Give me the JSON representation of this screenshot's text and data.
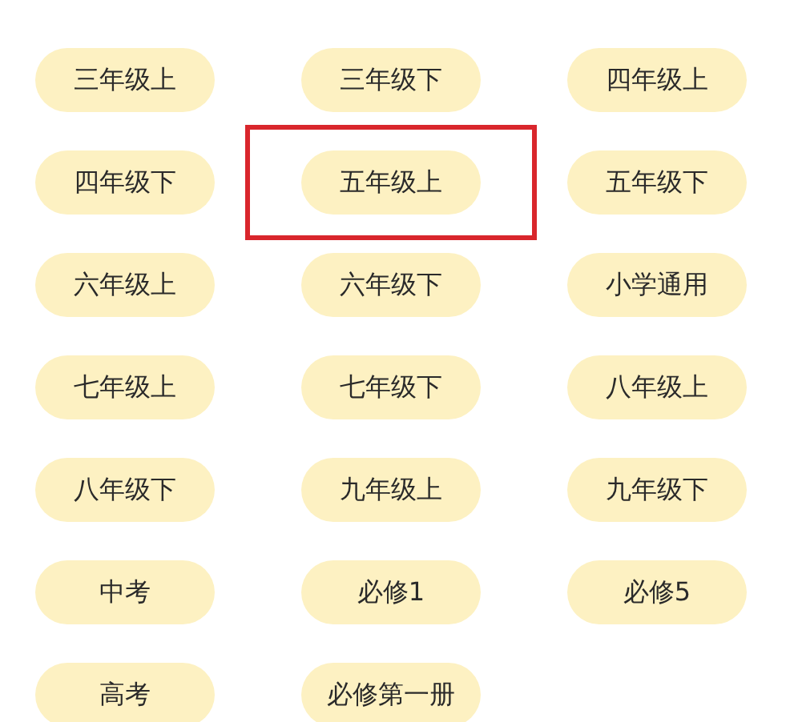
{
  "grades": [
    {
      "label": "三年级上",
      "highlighted": false
    },
    {
      "label": "三年级下",
      "highlighted": false
    },
    {
      "label": "四年级上",
      "highlighted": false
    },
    {
      "label": "四年级下",
      "highlighted": false
    },
    {
      "label": "五年级上",
      "highlighted": true
    },
    {
      "label": "五年级下",
      "highlighted": false
    },
    {
      "label": "六年级上",
      "highlighted": false
    },
    {
      "label": "六年级下",
      "highlighted": false
    },
    {
      "label": "小学通用",
      "highlighted": false
    },
    {
      "label": "七年级上",
      "highlighted": false
    },
    {
      "label": "七年级下",
      "highlighted": false
    },
    {
      "label": "八年级上",
      "highlighted": false
    },
    {
      "label": "八年级下",
      "highlighted": false
    },
    {
      "label": "九年级上",
      "highlighted": false
    },
    {
      "label": "九年级下",
      "highlighted": false
    },
    {
      "label": "中考",
      "highlighted": false
    },
    {
      "label": "必修1",
      "highlighted": false
    },
    {
      "label": "必修5",
      "highlighted": false
    },
    {
      "label": "高考",
      "highlighted": false
    },
    {
      "label": "必修第一册",
      "highlighted": false
    }
  ]
}
